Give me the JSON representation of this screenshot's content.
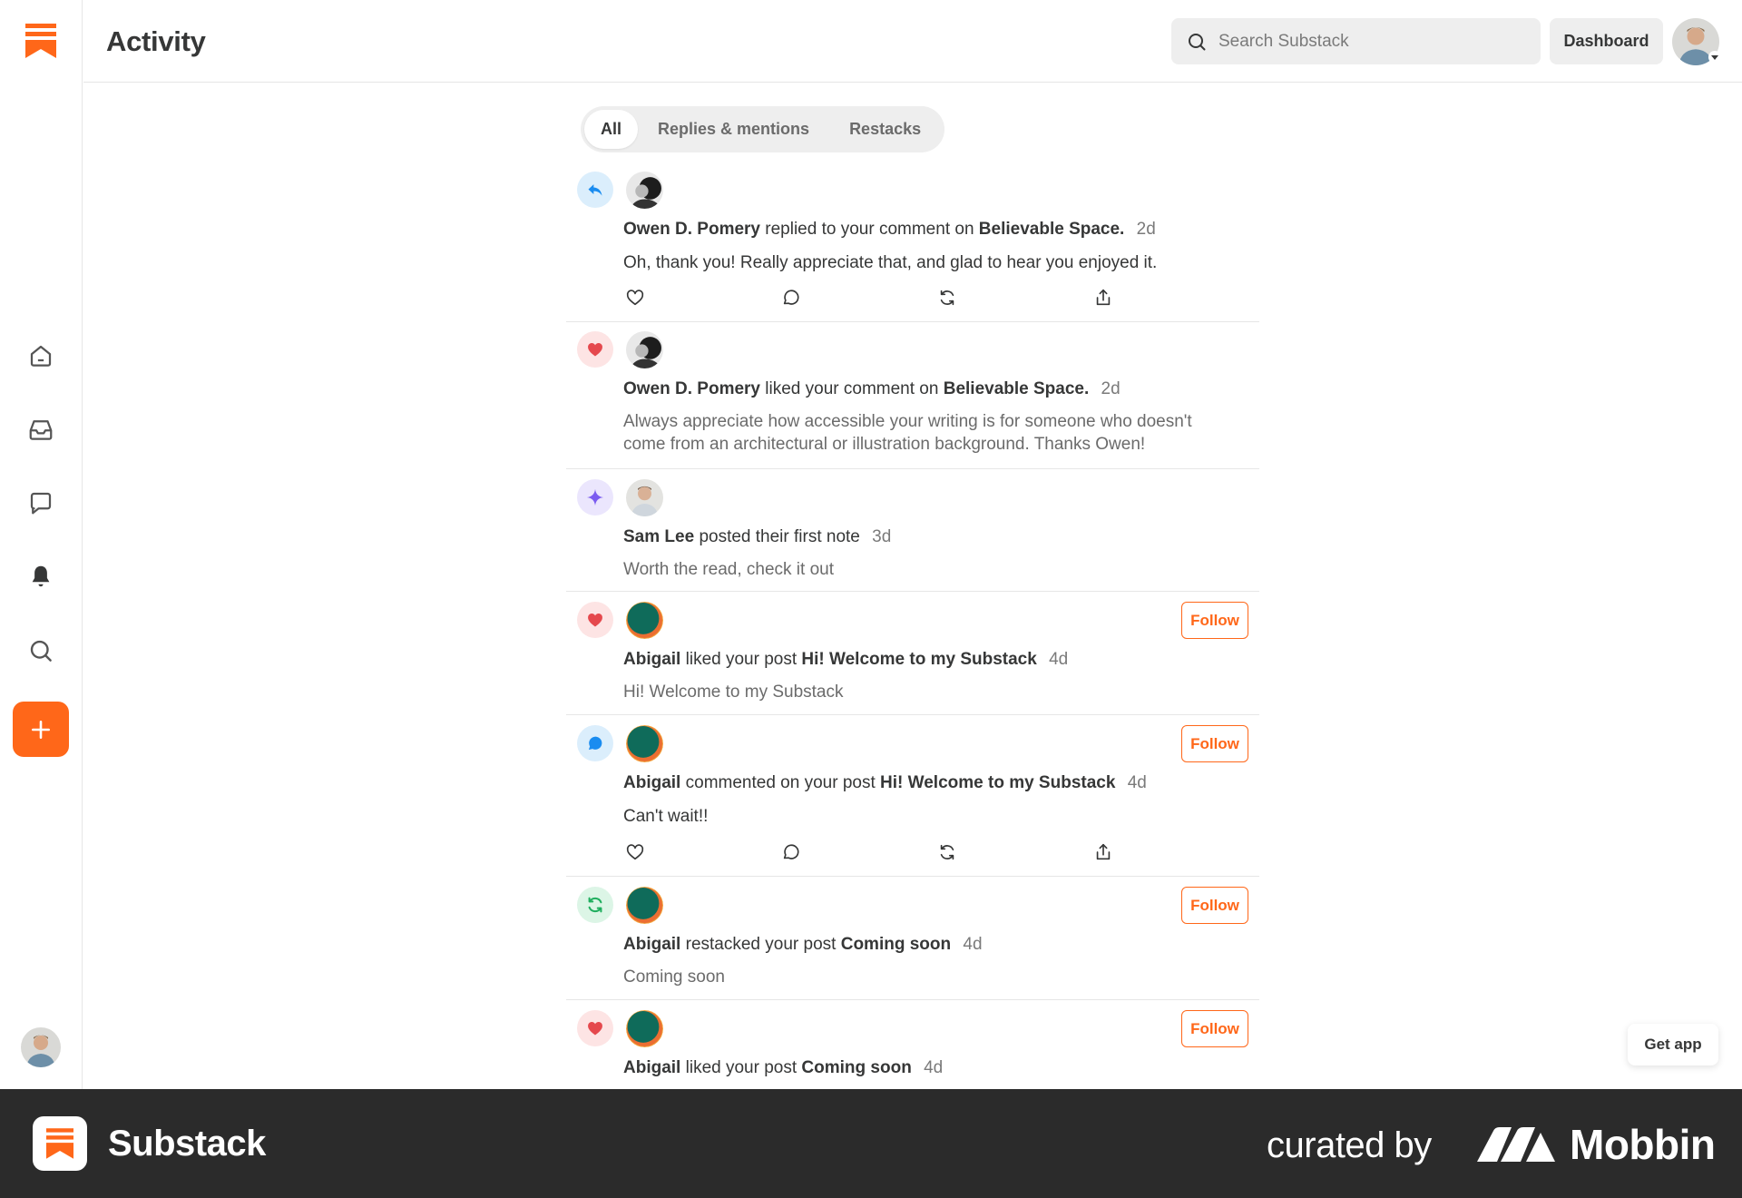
{
  "app": {
    "brand_color": "#ff6719"
  },
  "header": {
    "title": "Activity",
    "search_placeholder": "Search Substack",
    "dashboard_label": "Dashboard"
  },
  "sidebar": {
    "items": [
      {
        "name": "home",
        "icon": "home-icon"
      },
      {
        "name": "inbox",
        "icon": "inbox-icon"
      },
      {
        "name": "chat",
        "icon": "chat-icon"
      },
      {
        "name": "activity",
        "icon": "bell-icon",
        "active": true
      },
      {
        "name": "search",
        "icon": "search-icon"
      }
    ],
    "create_icon": "plus-icon"
  },
  "tabs": [
    {
      "label": "All",
      "active": true
    },
    {
      "label": "Replies & mentions",
      "active": false
    },
    {
      "label": "Restacks",
      "active": false
    }
  ],
  "feed": [
    {
      "type": "reply",
      "actor": "Owen D. Pomery",
      "verb": "replied to your comment on",
      "target": "Believable Space.",
      "time": "2d",
      "body": "Oh, thank you! Really appreciate that, and glad to hear you enjoyed it.",
      "has_actions": true
    },
    {
      "type": "like",
      "actor": "Owen D. Pomery",
      "verb": "liked your comment on",
      "target": "Believable Space.",
      "time": "2d",
      "body_line1": "Always appreciate how accessible your writing is for someone who doesn't",
      "body_line2": "come from an architectural or illustration background. Thanks Owen!"
    },
    {
      "type": "note",
      "actor": "Sam Lee",
      "verb": "posted their first note",
      "target": "",
      "time": "3d",
      "body": "Worth the read, check it out"
    },
    {
      "type": "like",
      "actor": "Abigail",
      "verb": "liked your post",
      "target": "Hi! Welcome to my Substack",
      "time": "4d",
      "body": "Hi! Welcome to my Substack",
      "follow_label": "Follow"
    },
    {
      "type": "comment",
      "actor": "Abigail",
      "verb": "commented on your post",
      "target": "Hi! Welcome to my Substack",
      "time": "4d",
      "body": "Can't wait!!",
      "follow_label": "Follow",
      "has_actions": true
    },
    {
      "type": "restack",
      "actor": "Abigail",
      "verb": "restacked your post",
      "target": "Coming soon",
      "time": "4d",
      "body": "Coming soon",
      "follow_label": "Follow"
    },
    {
      "type": "like",
      "actor": "Abigail",
      "verb": "liked your post",
      "target": "Coming soon",
      "time": "4d",
      "follow_label": "Follow"
    }
  ],
  "get_app_label": "Get app",
  "footer": {
    "brand": "Substack",
    "curated_by": "curated by",
    "curator": "Mobbin"
  }
}
